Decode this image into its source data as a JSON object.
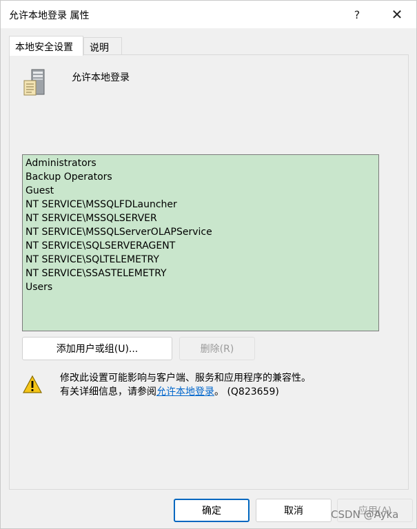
{
  "window": {
    "title": "允许本地登录 属性",
    "help_label": "?",
    "close_label": "✕"
  },
  "tabs": [
    {
      "label": "本地安全设置",
      "active": true
    },
    {
      "label": "说明",
      "active": false
    }
  ],
  "policy": {
    "title": "允许本地登录",
    "icon": "server-icon"
  },
  "members": [
    "Administrators",
    "Backup Operators",
    "Guest",
    "NT SERVICE\\MSSQLFDLauncher",
    "NT SERVICE\\MSSQLSERVER",
    "NT SERVICE\\MSSQLServerOLAPService",
    "NT SERVICE\\SQLSERVERAGENT",
    "NT SERVICE\\SQLTELEMETRY",
    "NT SERVICE\\SSASTELEMETRY",
    "Users"
  ],
  "buttons": {
    "add": "添加用户或组(U)...",
    "remove": "删除(R)"
  },
  "warning": {
    "icon": "warning-icon",
    "line1": "修改此设置可能影响与客户端、服务和应用程序的兼容性。",
    "line2_prefix": "有关详细信息，请参阅",
    "line2_link": "允许本地登录",
    "line2_suffix": "。 (Q823659)"
  },
  "footer": {
    "ok": "确定",
    "cancel": "取消",
    "apply": "应用(A)"
  },
  "watermark": "CSDN @Ayka",
  "colors": {
    "list_background": "#c9e6cc",
    "link": "#0066cc",
    "default_button_border": "#0067c0"
  }
}
